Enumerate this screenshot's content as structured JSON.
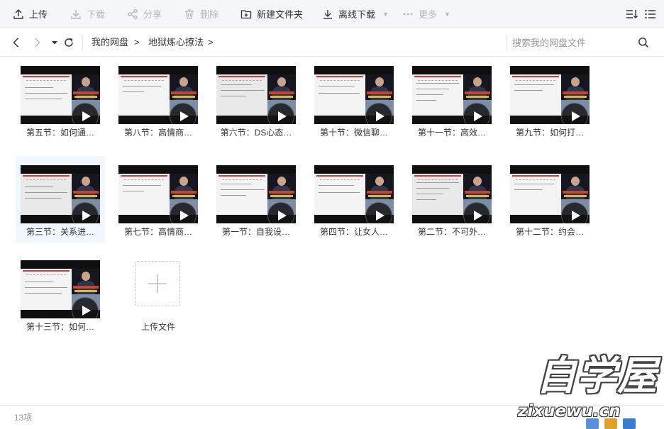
{
  "toolbar": {
    "upload": "上传",
    "download": "下载",
    "share": "分享",
    "delete": "删除",
    "new_folder": "新建文件夹",
    "offline_download": "离线下载",
    "more": "更多"
  },
  "nav": {
    "breadcrumb": [
      "我的网盘",
      "地狱炼心撩法"
    ],
    "separator": ">",
    "search_placeholder": "搜索我的网盘文件"
  },
  "files": [
    {
      "name": "第五节：如何通…",
      "selected": false
    },
    {
      "name": "第八节：高情商…",
      "selected": false
    },
    {
      "name": "第六节：DS心态…",
      "selected": false
    },
    {
      "name": "第十节：微信聊…",
      "selected": false
    },
    {
      "name": "第十一节：高效…",
      "selected": false
    },
    {
      "name": "第九节：如何打…",
      "selected": false
    },
    {
      "name": "第三节：关系进…",
      "selected": true
    },
    {
      "name": "第七节：高情商…",
      "selected": false
    },
    {
      "name": "第一节：自我设…",
      "selected": false
    },
    {
      "name": "第四节：让女人…",
      "selected": false
    },
    {
      "name": "第二节：不可外…",
      "selected": false
    },
    {
      "name": "第十二节：约会…",
      "selected": false
    },
    {
      "name": "第十三节：如何…",
      "selected": false
    }
  ],
  "upload_tile": {
    "label": "上传文件"
  },
  "status": {
    "count": "13项"
  },
  "watermark": {
    "main": "自学屋",
    "sub": "zixuewu.cn"
  },
  "colors": {
    "accent": "#06a7ff",
    "toolbar_bg": "#f5f6f8",
    "selected_bg": "#f0f7ff",
    "text": "#333333",
    "muted": "#999999"
  }
}
